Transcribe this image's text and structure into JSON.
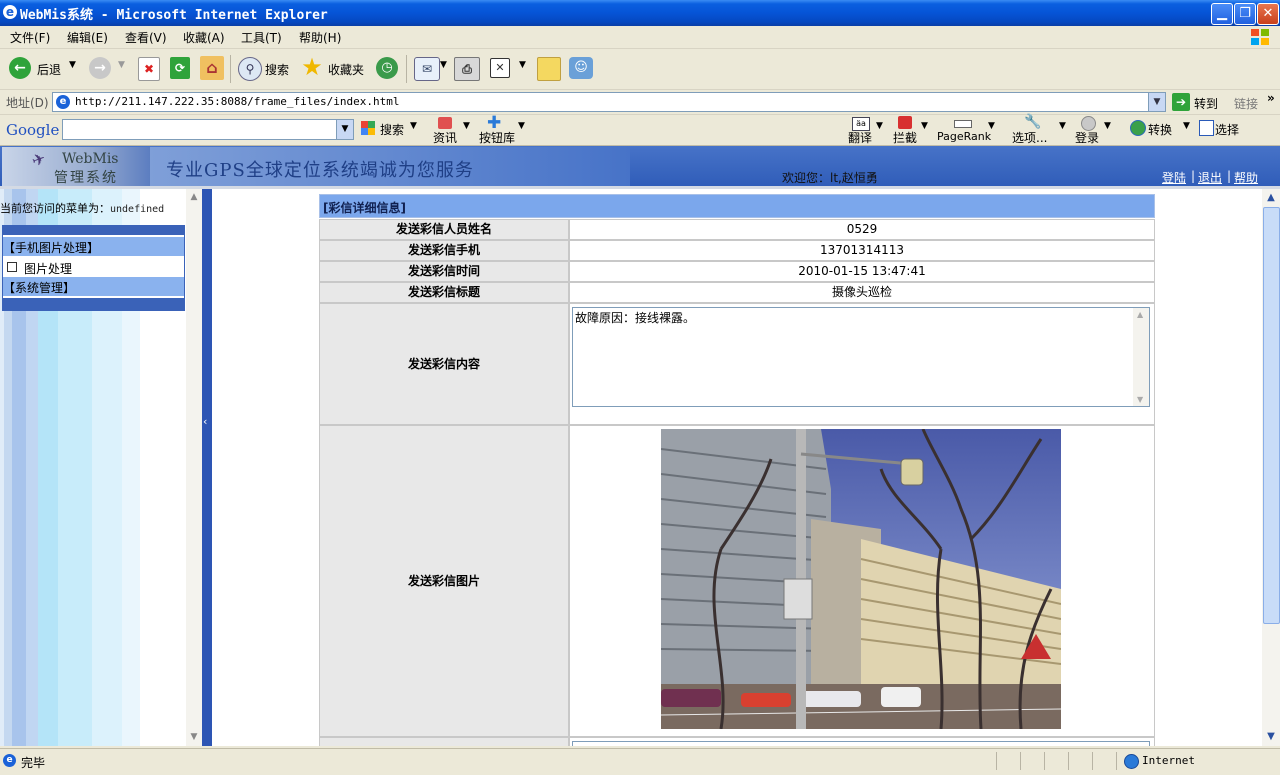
{
  "window": {
    "title": "WebMis系统 - Microsoft Internet Explorer"
  },
  "menu": [
    "文件(F)",
    "编辑(E)",
    "查看(V)",
    "收藏(A)",
    "工具(T)",
    "帮助(H)"
  ],
  "toolbar": {
    "back": "后退",
    "search": "搜索",
    "favorites": "收藏夹"
  },
  "address": {
    "label": "地址(D)",
    "url": "http://211.147.222.35:8088/frame_files/index.html",
    "go": "转到",
    "links": "链接"
  },
  "googlebar": {
    "brand": "Google",
    "search": "搜索",
    "news": "资讯",
    "buttons": "按钮库",
    "translate": "翻译",
    "block": "拦截",
    "pagerank": "PageRank",
    "options": "选项...",
    "login": "登录",
    "convert": "转换",
    "select": "选择"
  },
  "header": {
    "logo_line1": "WebMis",
    "logo_line2": "管理系统",
    "slogan": "专业GPS全球定位系统竭诚为您服务",
    "welcome": "欢迎您：lt,赵恒勇",
    "links": [
      "登陆",
      "退出",
      "帮助"
    ]
  },
  "sidebar": {
    "current_label": "当前您访问的菜单为：",
    "current_value": "undefined",
    "groups": [
      {
        "title": "【手机图片处理】",
        "items": [
          "图片处理"
        ]
      },
      {
        "title": "【系统管理】",
        "items": []
      }
    ]
  },
  "detail": {
    "heading": "[彩信详细信息]",
    "rows": [
      {
        "label": "发送彩信人员姓名",
        "value": "0529"
      },
      {
        "label": "发送彩信手机",
        "value": "13701314113"
      },
      {
        "label": "发送彩信时间",
        "value": "2010-01-15 13:47:41"
      },
      {
        "label": "发送彩信标题",
        "value": "摄像头巡检"
      }
    ],
    "content_label": "发送彩信内容",
    "content_value": "故障原因：接线裸露。",
    "image_label": "发送彩信图片"
  },
  "status": {
    "text": "完毕",
    "zone": "Internet"
  },
  "colors": {
    "header_blue": "#3a64bf",
    "table_head": "#7ba7ec",
    "label_bg": "#e8e8e8",
    "splitter": "#2d55b4"
  }
}
